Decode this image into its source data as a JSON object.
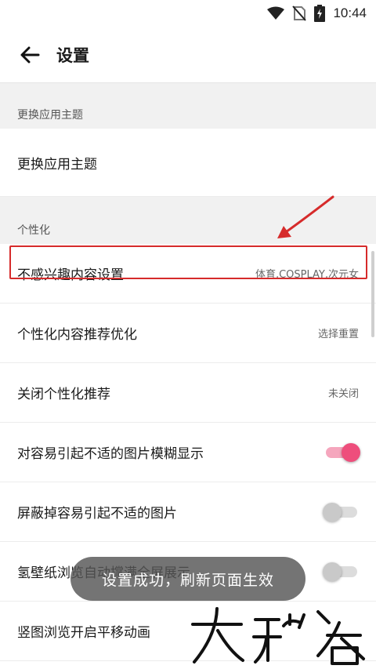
{
  "status_bar": {
    "time": "10:44",
    "icons": [
      "wifi-icon",
      "no-sim-icon",
      "battery-charging-icon"
    ]
  },
  "app_bar": {
    "title": "设置",
    "back_icon": "arrow-left-icon"
  },
  "sections": [
    {
      "header": "更换应用主题",
      "rows": [
        {
          "label": "更换应用主题"
        }
      ]
    },
    {
      "header": "个性化",
      "rows": [
        {
          "label": "不感兴趣内容设置",
          "value": "体育,COSPLAY,次元女"
        },
        {
          "label": "个性化内容推荐优化",
          "value": "选择重置"
        },
        {
          "label": "关闭个性化推荐",
          "value": "未关闭"
        },
        {
          "label": "对容易引起不适的图片模糊显示",
          "toggle": true
        },
        {
          "label": "屏蔽掉容易引起不适的图片",
          "toggle": false
        },
        {
          "label": "氢壁纸浏览自动撑满全屏展示",
          "toggle": false
        },
        {
          "label": "竖图浏览开启平移动画"
        }
      ]
    }
  ],
  "toast": "设置成功，刷新页面生效",
  "watermark": "大玩客",
  "colors": {
    "accent_pink": "#ee4e7c",
    "highlight_red": "#d62b2b"
  }
}
